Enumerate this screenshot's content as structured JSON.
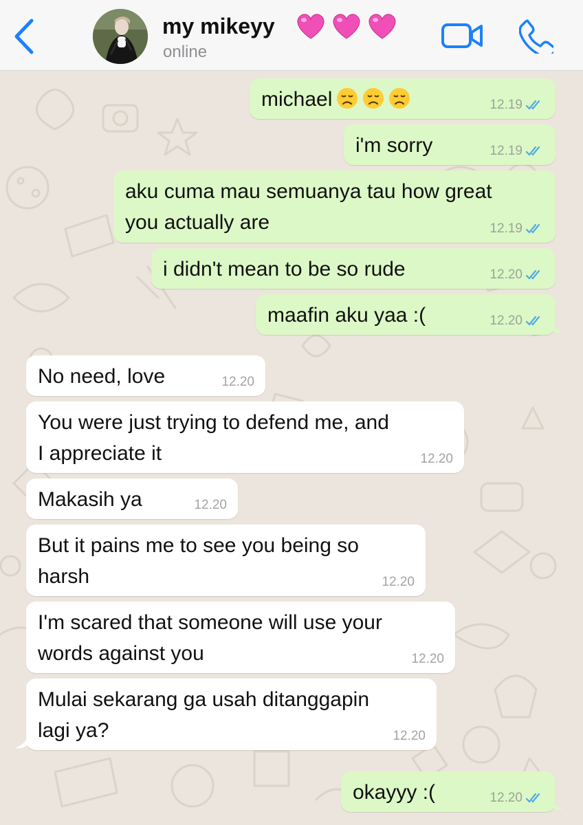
{
  "header": {
    "contact_name": "my mikeyy",
    "status": "online",
    "back_icon": "chevron-left-icon",
    "video_icon": "video-call-icon",
    "phone_icon": "phone-icon",
    "accent": "#1a82fb"
  },
  "colors": {
    "outgoing_bubble": "#dcf8c6",
    "incoming_bubble": "#ffffff",
    "read_ticks": "#4fa9e8",
    "wallpaper": "#ece5dd",
    "hearts": "#f04fb7"
  },
  "messages": [
    {
      "dir": "out",
      "text": "michael",
      "emoji": [
        "disappointed-face",
        "disappointed-face",
        "disappointed-face"
      ],
      "time": "12.19",
      "read": true
    },
    {
      "dir": "out",
      "text": "i'm sorry",
      "time": "12.19",
      "read": true
    },
    {
      "dir": "out",
      "line1": "aku cuma mau semuanya tau how great",
      "line2": "you actually are",
      "time": "12.19",
      "read": true
    },
    {
      "dir": "out",
      "text": "i didn't mean to be so rude",
      "time": "12.20",
      "read": true
    },
    {
      "dir": "out",
      "text": "maafin aku yaa :(",
      "time": "12.20",
      "read": true
    },
    {
      "dir": "in",
      "text": "No need, love",
      "time": "12.20"
    },
    {
      "dir": "in",
      "line1": "You were just trying to defend me, and",
      "line2": "I appreciate it",
      "time": "12.20"
    },
    {
      "dir": "in",
      "text": "Makasih ya",
      "time": "12.20"
    },
    {
      "dir": "in",
      "line1": "But it pains me to see you being so",
      "line2": "harsh",
      "time": "12.20"
    },
    {
      "dir": "in",
      "line1": "I'm scared that someone will use your",
      "line2": "words against you",
      "time": "12.20"
    },
    {
      "dir": "in",
      "line1": "Mulai sekarang ga usah ditanggapin",
      "line2": "lagi ya?",
      "time": "12.20"
    },
    {
      "dir": "out",
      "text": "okayyy :(",
      "time": "12.20",
      "read": true
    }
  ]
}
